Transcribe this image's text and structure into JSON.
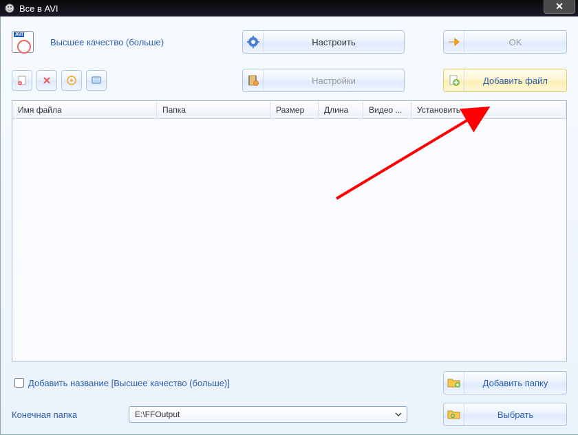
{
  "window": {
    "title": "Все в AVI"
  },
  "quality": {
    "label": "Высшее качество (больше)"
  },
  "buttons": {
    "configure": "Настроить",
    "ok": "OK",
    "settings": "Настройки",
    "add_file": "Добавить файл",
    "add_folder": "Добавить папку",
    "select": "Выбрать"
  },
  "table": {
    "cols": {
      "filename": "Имя файла",
      "folder": "Папка",
      "size": "Размер",
      "length": "Длина",
      "video": "Видео ...",
      "set": "Установить ..."
    }
  },
  "checkbox": {
    "add_title_prefix": "Добавить название",
    "add_title_suffix": "[Высшее качество (больше)]"
  },
  "output": {
    "label": "Конечная папка",
    "value": "E:\\FFOutput"
  }
}
